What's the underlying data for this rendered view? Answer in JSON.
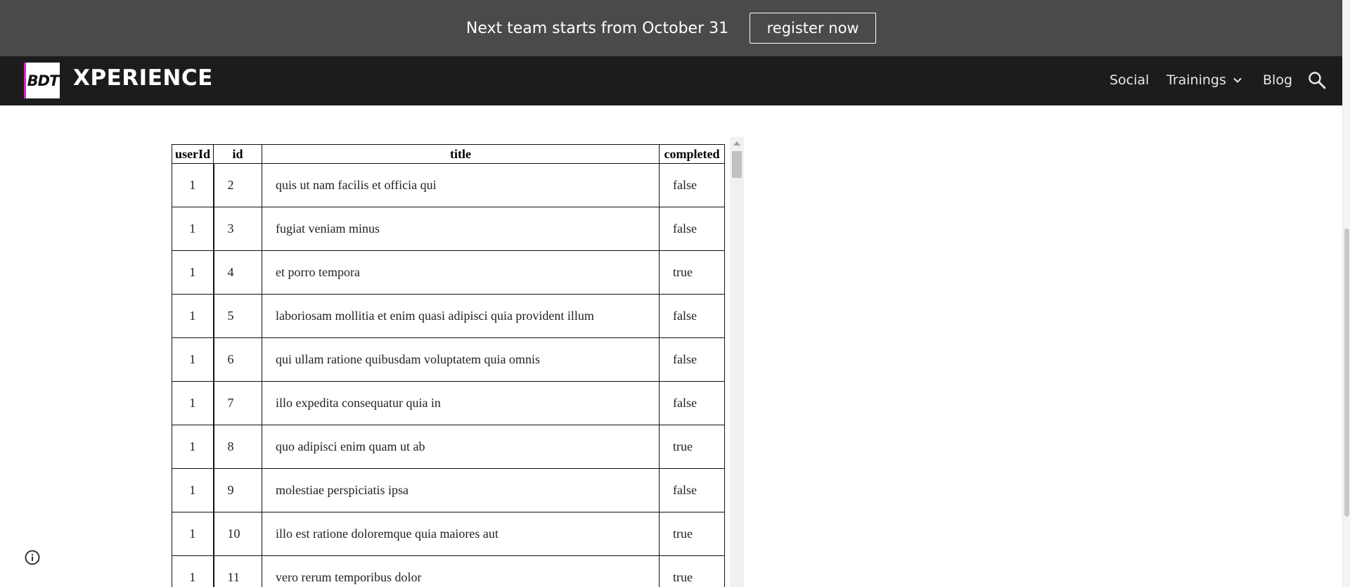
{
  "announcement": {
    "text": "Next team starts from October 31",
    "button_label": "register now"
  },
  "header": {
    "logo_text": "BDT",
    "brand": "XPERIENCE",
    "nav": {
      "social": "Social",
      "trainings": "Trainings",
      "blog": "Blog"
    },
    "icons": [
      "chevron-down-icon",
      "search-icon"
    ]
  },
  "table": {
    "columns": [
      "userId",
      "id",
      "title",
      "completed"
    ],
    "rows": [
      [
        "1",
        "2",
        "quis ut nam facilis et officia qui",
        "false"
      ],
      [
        "1",
        "3",
        "fugiat veniam minus",
        "false"
      ],
      [
        "1",
        "4",
        "et porro tempora",
        "true"
      ],
      [
        "1",
        "5",
        "laboriosam mollitia et enim quasi adipisci quia provident illum",
        "false"
      ],
      [
        "1",
        "6",
        "qui ullam ratione quibusdam voluptatem quia omnis",
        "false"
      ],
      [
        "1",
        "7",
        "illo expedita consequatur quia in",
        "false"
      ],
      [
        "1",
        "8",
        "quo adipisci enim quam ut ab",
        "true"
      ],
      [
        "1",
        "9",
        "molestiae perspiciatis ipsa",
        "false"
      ],
      [
        "1",
        "10",
        "illo est ratione doloremque quia maiores aut",
        "true"
      ],
      [
        "1",
        "11",
        "vero rerum temporibus dolor",
        "true"
      ]
    ]
  },
  "footer": {
    "icons": [
      "info-icon"
    ]
  }
}
